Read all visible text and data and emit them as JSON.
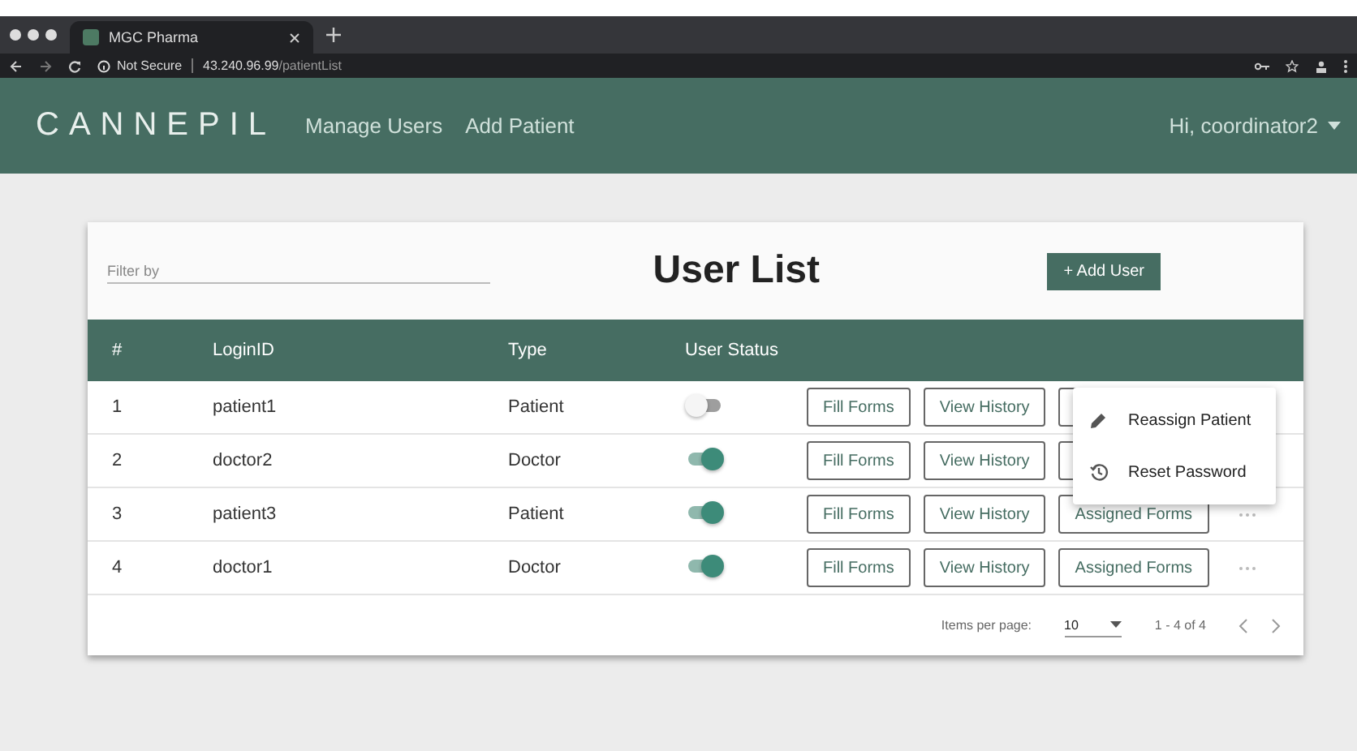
{
  "browser": {
    "tab_title": "MGC Pharma",
    "security": "Not Secure",
    "url_host": "43.240.96.99",
    "url_path": "/patientList"
  },
  "navbar": {
    "logo": "CANNEPIL",
    "links": [
      "Manage Users",
      "Add Patient"
    ],
    "user": "Hi, coordinator2"
  },
  "card": {
    "filter_placeholder": "Filter by",
    "title": "User List",
    "add_button": "+ Add User"
  },
  "table": {
    "columns": [
      "#",
      "LoginID",
      "Type",
      "User Status"
    ],
    "rows": [
      {
        "index": "1",
        "login": "patient1",
        "type": "Patient",
        "active": false,
        "actions": [
          "Fill Forms",
          "View History"
        ]
      },
      {
        "index": "2",
        "login": "doctor2",
        "type": "Doctor",
        "active": true,
        "actions": [
          "Fill Forms",
          "View History"
        ]
      },
      {
        "index": "3",
        "login": "patient3",
        "type": "Patient",
        "active": true,
        "actions": [
          "Fill Forms",
          "View History",
          "Assigned Forms"
        ]
      },
      {
        "index": "4",
        "login": "doctor1",
        "type": "Doctor",
        "active": true,
        "actions": [
          "Fill Forms",
          "View History",
          "Assigned Forms"
        ]
      }
    ]
  },
  "paginator": {
    "label": "Items per page:",
    "page_size": "10",
    "range": "1 - 4 of 4"
  },
  "menu": [
    {
      "kind": "edit",
      "label": "Reassign Patient"
    },
    {
      "kind": "history",
      "label": "Reset Password"
    }
  ]
}
